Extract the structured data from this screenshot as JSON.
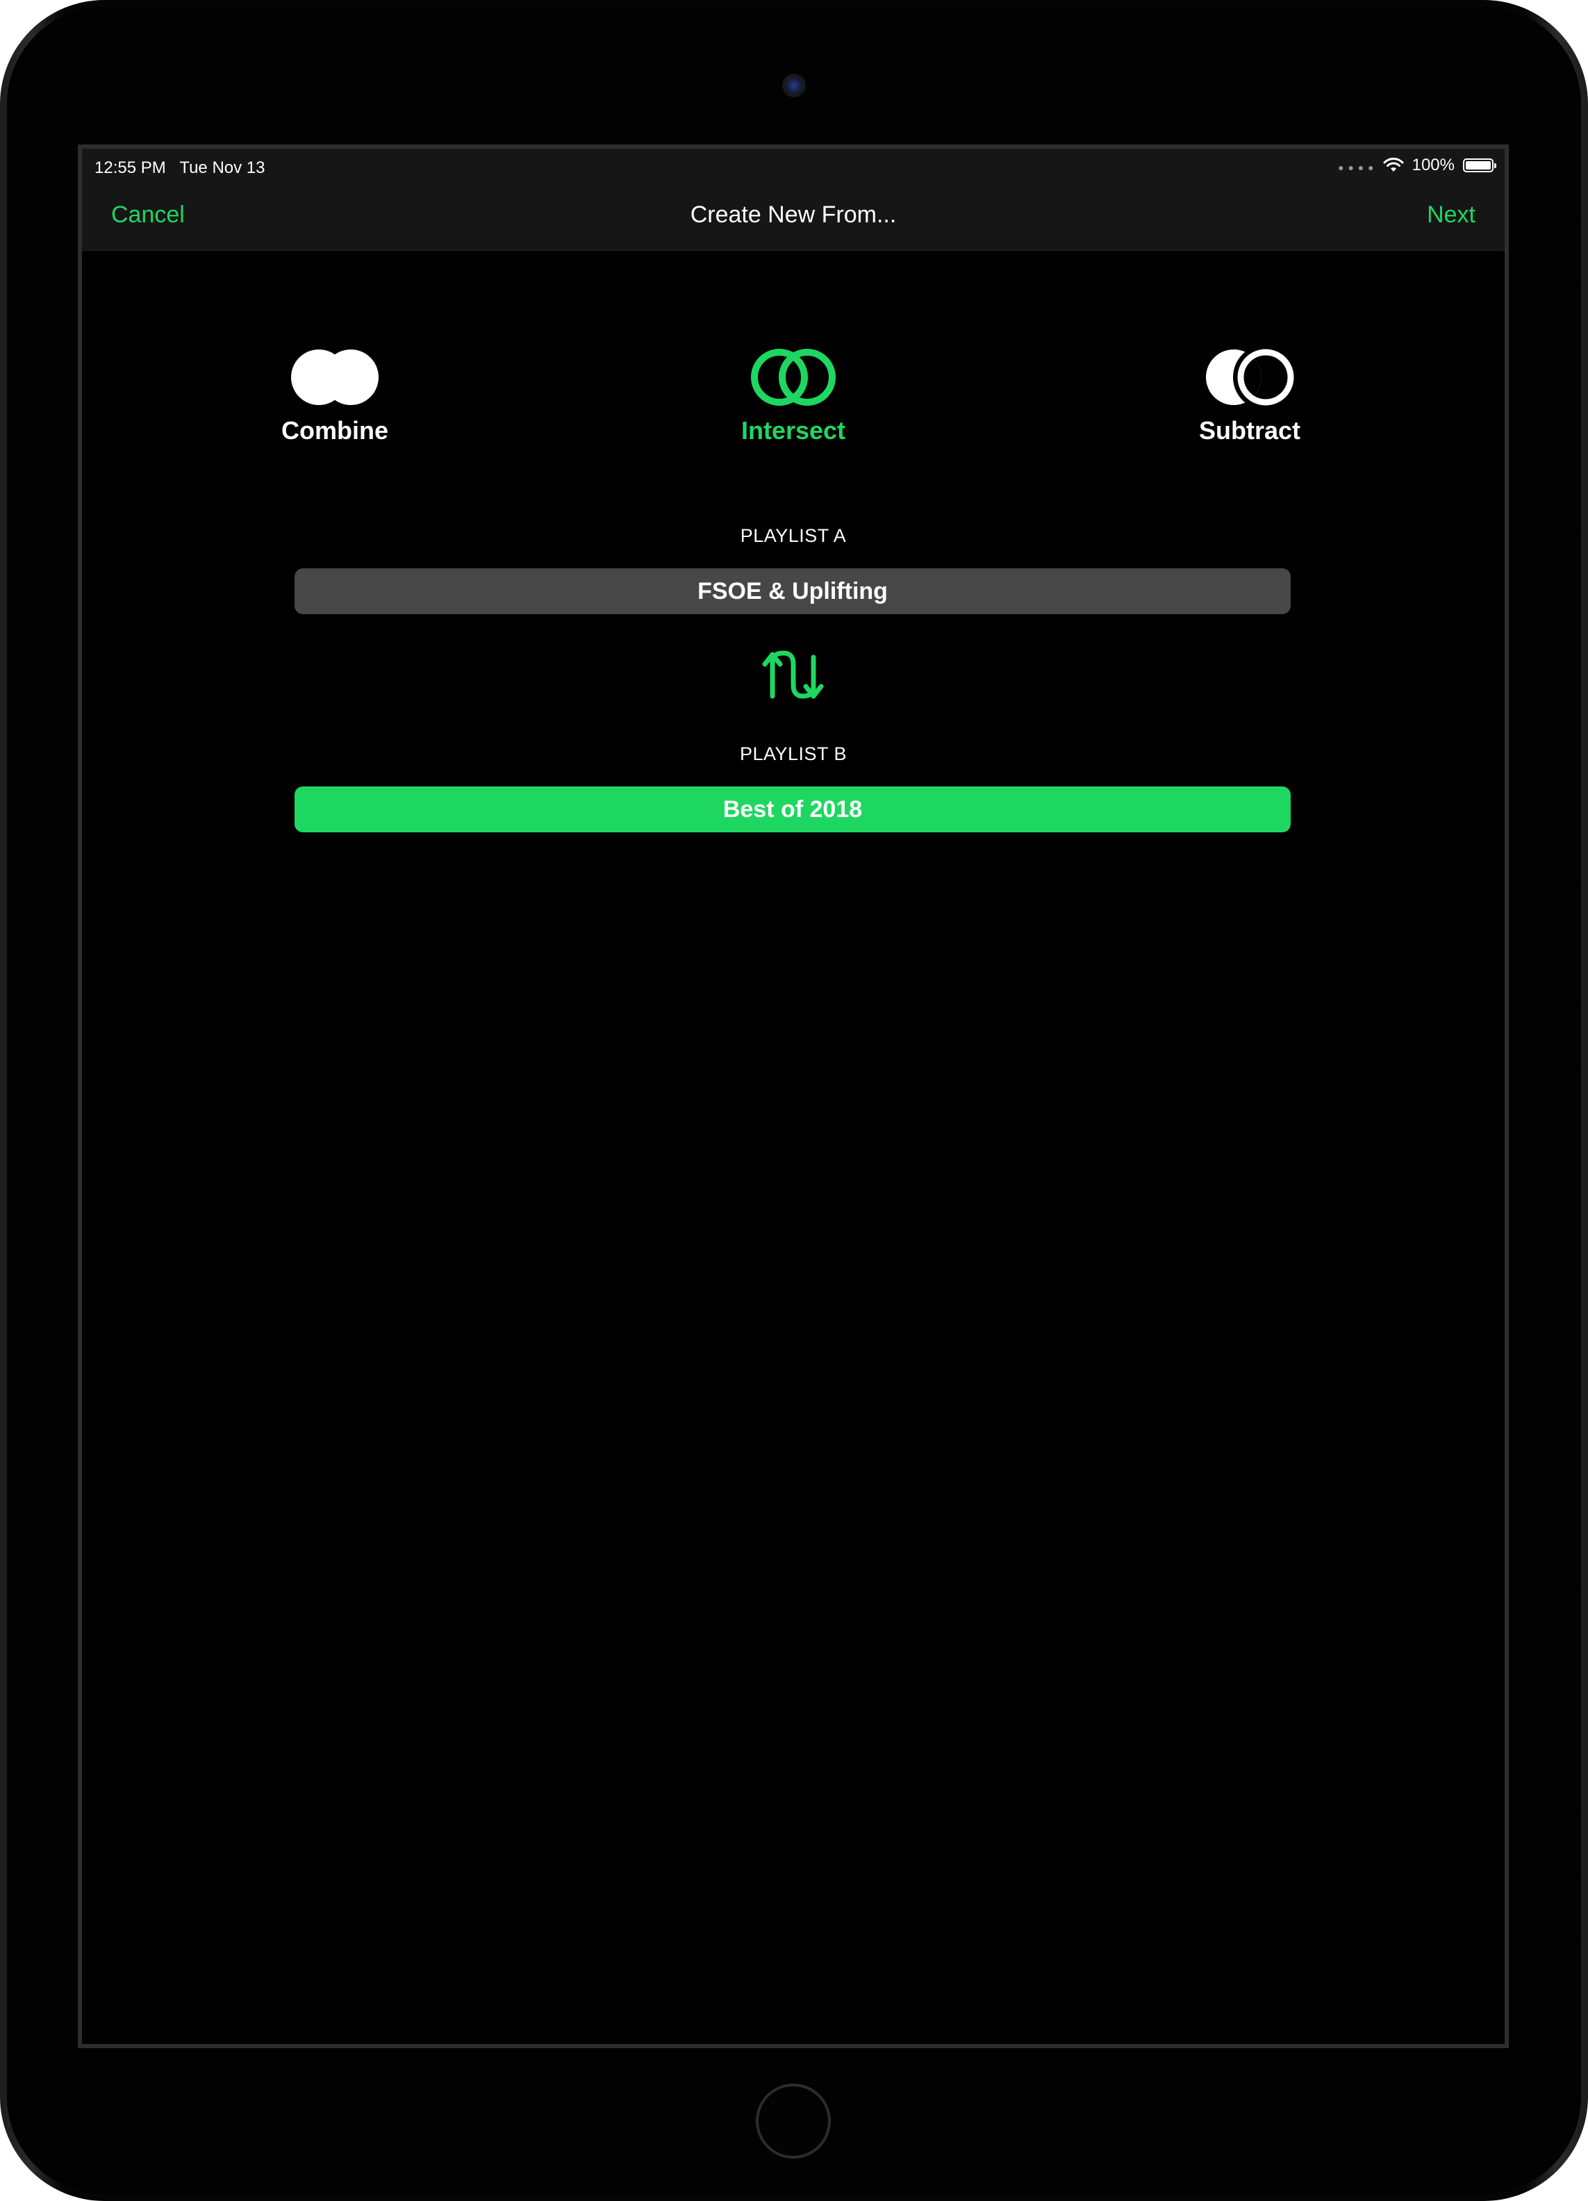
{
  "status_bar": {
    "time": "12:55 PM",
    "date": "Tue Nov 13",
    "battery": "100%",
    "battery_level": 1.0
  },
  "nav": {
    "cancel_label": "Cancel",
    "title": "Create New From...",
    "next_label": "Next"
  },
  "operations": {
    "selected": "Intersect",
    "items": [
      {
        "label": "Combine",
        "icon": "combine-icon"
      },
      {
        "label": "Intersect",
        "icon": "intersect-icon"
      },
      {
        "label": "Subtract",
        "icon": "subtract-icon"
      }
    ]
  },
  "playlist_a": {
    "section_label": "PLAYLIST A",
    "name": "FSOE & Uplifting"
  },
  "swap": {
    "icon": "swap-arrows-icon"
  },
  "playlist_b": {
    "section_label": "PLAYLIST B",
    "name": "Best of 2018"
  },
  "colors": {
    "accent": "#1ed760",
    "nav_background": "#161616",
    "screen_background": "#000000",
    "playlist_a_background": "#474747",
    "playlist_b_background": "#1ed760",
    "text": "#ffffff"
  }
}
